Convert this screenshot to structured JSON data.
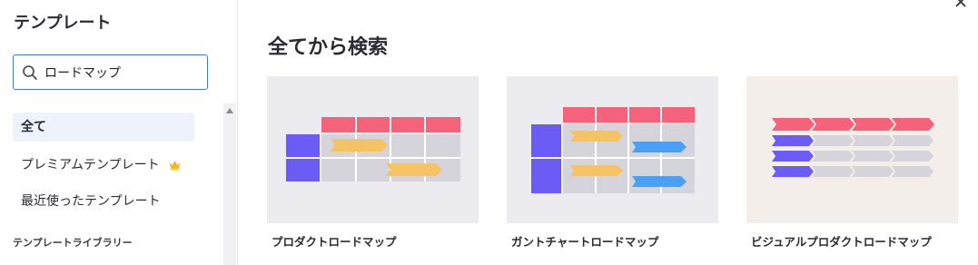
{
  "sidebar": {
    "title": "テンプレート",
    "search": {
      "value": "ロードマップ",
      "placeholder": ""
    },
    "nav": {
      "all": "全て",
      "premium": "プレミアムテンプレート",
      "recent": "最近使ったテンプレート"
    },
    "section_label": "テンプレートライブラリー"
  },
  "main": {
    "title": "全てから検索",
    "cards": [
      {
        "label": "プロダクトロードマップ"
      },
      {
        "label": "ガントチャートロードマップ"
      },
      {
        "label": "ビジュアルプロダクトロードマップ"
      }
    ]
  },
  "colors": {
    "accent_blue": "#4a78d4",
    "pink": "#f5637a",
    "purple": "#6b5cf6",
    "yellow": "#f5c363",
    "blue": "#4aa0f5",
    "grid": "#d4d4da",
    "crown": "#f5b623"
  },
  "icons": [
    "search-icon",
    "crown-icon",
    "close-icon",
    "scroll-up-arrow-icon"
  ]
}
